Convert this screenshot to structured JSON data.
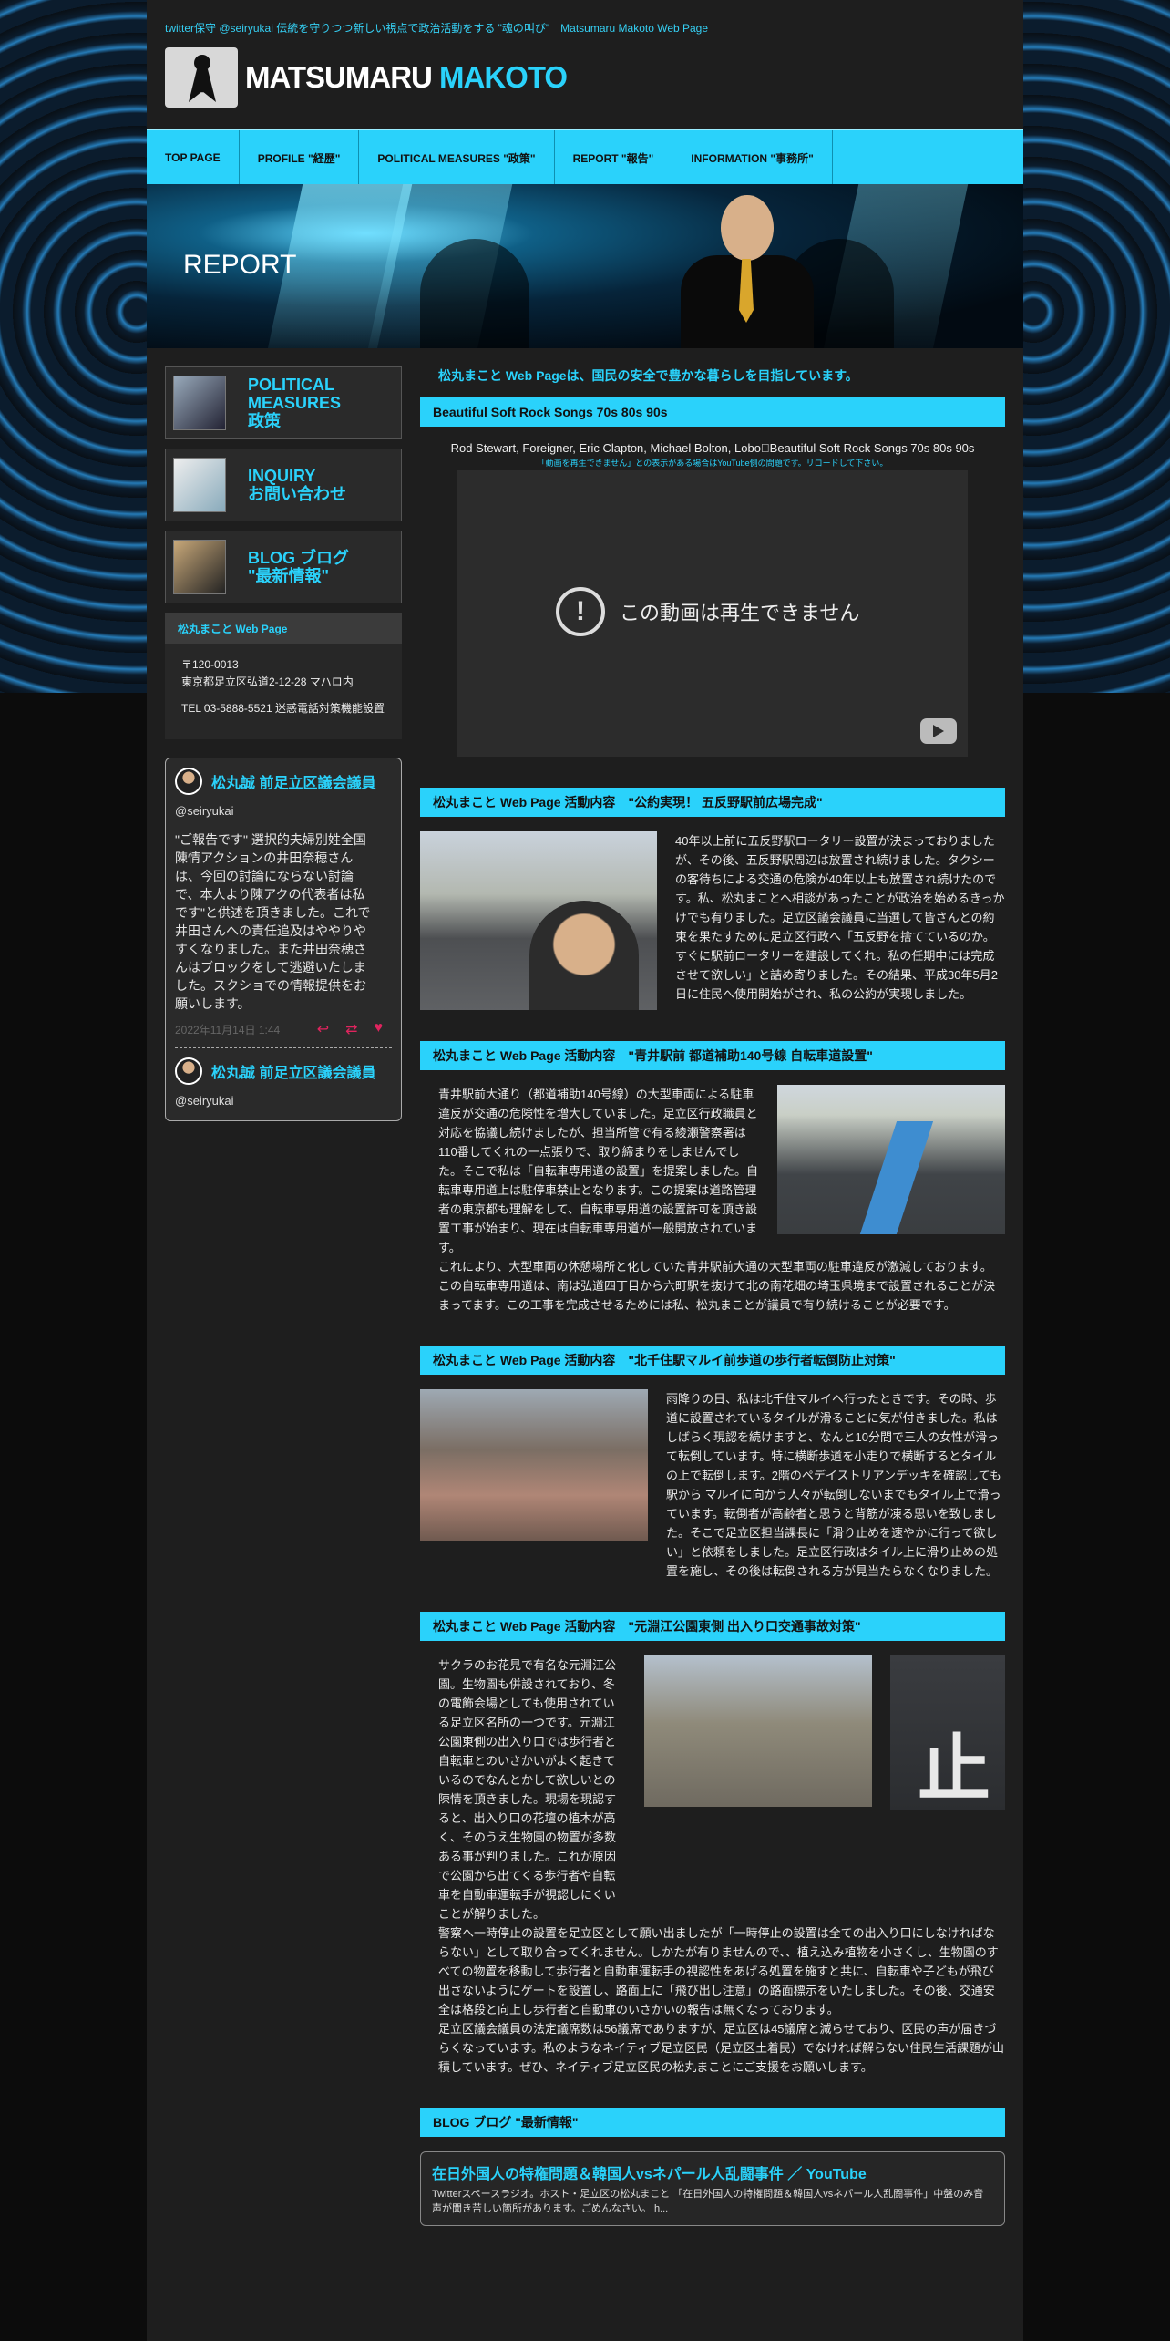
{
  "header": {
    "tagline": "twitter保守 @seiryukai 伝統を守りつつ新しい視点で政治活動をする \"魂の叫び\"　Matsumaru Makoto Web Page",
    "logo_first": "MATSUMARU",
    "logo_second": "MAKOTO"
  },
  "nav": {
    "items": [
      {
        "label": "TOP PAGE"
      },
      {
        "label": "PROFILE \"経歴\""
      },
      {
        "label": "POLITICAL MEASURES \"政策\""
      },
      {
        "label": "REPORT \"報告\""
      },
      {
        "label": "INFORMATION \"事務所\""
      }
    ]
  },
  "hero": {
    "title": "REPORT"
  },
  "sidebar": {
    "banners": [
      {
        "line1": "POLITICAL",
        "line2": "MEASURES",
        "line3": "政策"
      },
      {
        "line1": "INQUIRY",
        "line2": "お問い合わせ",
        "line3": ""
      },
      {
        "line1": "BLOG ブログ",
        "line2": "\"最新情報\"",
        "line3": ""
      }
    ],
    "info_title": "松丸まこと Web Page",
    "postal": "〒120-0013",
    "address": "東京都足立区弘道2-12-28 マハロ内",
    "tel": "TEL 03-5888-5521 迷惑電話対策機能設置",
    "tweets": [
      {
        "name": "松丸誠 前足立区議会議員",
        "handle": "@seiryukai",
        "text": "\"ご報告です\" 選択的夫婦別姓全国陳情アクションの井田奈穂さんは、今回の討論にならない討論で、本人より陳アクの代表者は私です\"と供述を頂きました。これで井田さんへの責任追及はややりやすくなりました。また井田奈穂さんはブロックをして逃避いたしました。スクショでの情報提供をお願いします。",
        "date": "2022年11月14日 1:44"
      },
      {
        "name": "松丸誠 前足立区議会議員",
        "handle": "@seiryukai"
      }
    ]
  },
  "main": {
    "intro": "松丸まこと Web Pageは、国民の安全で豊かな暮らしを目指しています。",
    "video": {
      "heading": "Beautiful Soft Rock Songs 70s 80s 90s",
      "caption": "Rod Stewart, Foreigner, Eric Clapton, Michael Bolton, Lobo\u0000Beautiful Soft Rock Songs 70s 80s 90s",
      "note": "「動画を再生できません」との表示がある場合はYouTube側の問題です。リロードして下さい。",
      "message": "この動画は再生できません"
    },
    "sections": [
      {
        "heading": "松丸まこと Web Page 活動内容　\"公約実現！ 五反野駅前広場完成\"",
        "text": "40年以上前に五反野駅ロータリー設置が決まっておりましたが、その後、五反野駅周辺は放置され続けました。タクシーの客待ちによる交通の危険が40年以上も放置され続けたのです。私、松丸まことへ相談があったことが政治を始めるきっかけでも有りました。足立区議会議員に当選して皆さんとの約束を果たすために足立区行政へ「五反野を捨てているのか。すぐに駅前ロータリーを建設してくれ。私の任期中には完成させて欲しい」と詰め寄りました。その結果、平成30年5月2日に住民へ使用開始がされ、私の公約が実現しました。"
      },
      {
        "heading": "松丸まこと Web Page 活動内容　\"青井駅前 都道補助140号線 自転車道設置\"",
        "text": "青井駅前大通り（都道補助140号線）の大型車両による駐車違反が交通の危険性を増大していました。足立区行政職員と対応を協議し続けましたが、担当所管で有る綾瀬警察署は110番してくれの一点張りで、取り締まりをしませんでした。そこで私は「自転車専用道の設置」を提案しました。自転車専用道上は駐停車禁止となります。この提案は道路管理者の東京都も理解をして、自転車専用道の設置許可を頂き設置工事が始まり、現在は自転車専用道が一般開放されています。",
        "text2": "これにより、大型車両の休憩場所と化していた青井駅前大通の大型車両の駐車違反が激減しております。",
        "text3": "この自転車専用道は、南は弘道四丁目から六町駅を抜けて北の南花畑の埼玉県境まで設置されることが決まってます。この工事を完成させるためには私、松丸まことが議員で有り続けることが必要です。"
      },
      {
        "heading": "松丸まこと Web Page 活動内容　\"北千住駅マルイ前歩道の歩行者転倒防止対策\"",
        "text": "雨降りの日、私は北千住マルイへ行ったときです。その時、歩道に設置されているタイルが滑ることに気が付きました。私はしばらく現認を続けますと、なんと10分間で三人の女性が滑って転倒しています。特に横断歩道を小走りで横断するとタイルの上で転倒します。2階のペデイストリアンデッキを確認しても駅から マルイに向かう人々が転倒しないまでもタイル上で滑っています。転倒者が高齢者と思うと背筋が凍る思いを致しました。そこで足立区担当課長に「滑り止めを速やかに行って欲しい」と依頼をしました。足立区行政はタイル上に滑り止めの処置を施し、その後は転倒される方が見当たらなくなりました。"
      },
      {
        "heading": "松丸まこと Web Page 活動内容　\"元淵江公園東側 出入り口交通事故対策\"",
        "text": "サクラのお花見で有名な元淵江公園。生物園も併設されており、冬の電飾会場としても使用されている足立区名所の一つです。元淵江公園東側の出入り口では歩行者と自転車とのいさかいがよく起きているのでなんとかして欲しいとの陳情を頂きました。現場を現認すると、出入り口の花壇の植木が高く、そのうえ生物園の物置が多数ある事が判りました。これが原因で公園から出てくる歩行者や自転車を自動車運転手が視認しにくいことが解りました。",
        "text2": "警察へ一時停止の設置を足立区として願い出ましたが「一時停止の設置は全ての出入り口にしなければならない」として取り合ってくれません。しかたが有りませんので、、植え込み植物を小さくし、生物園のすべての物置を移動して歩行者と自動車運転手の視認性をあげる処置を施すと共に、自転車や子どもが飛び出さないようにゲートを設置し、路面上に「飛び出し注意」の路面標示をいたしました。その後、交通安全は格段と向上し歩行者と自動車のいさかいの報告は無くなっております。",
        "text3": "足立区議会議員の法定議席数は56議席でありますが、足立区は45議席と減らせており、区民の声が届きづらくなっています。私のようなネイティブ足立区民（足立区土着民）でなければ解らない住民生活課題が山積しています。ぜひ、ネイティブ足立区民の松丸まことにご支援をお願いします。"
      }
    ],
    "blog": {
      "heading": "BLOG ブログ \"最新情報\"",
      "title": "在日外国人の特権問題＆韓国人vsネパール人乱闘事件 ／ YouTube",
      "text": "Twitterスペースラジオ。ホスト・足立区の松丸まこと 「在日外国人の特権問題＆韓国人vsネパール人乱闘事件」中盤のみ音声が聞き苦しい箇所があります。ごめんなさい。 h..."
    }
  },
  "colors": {
    "accent": "#2ad2fb",
    "background": "#1e1e1e"
  }
}
